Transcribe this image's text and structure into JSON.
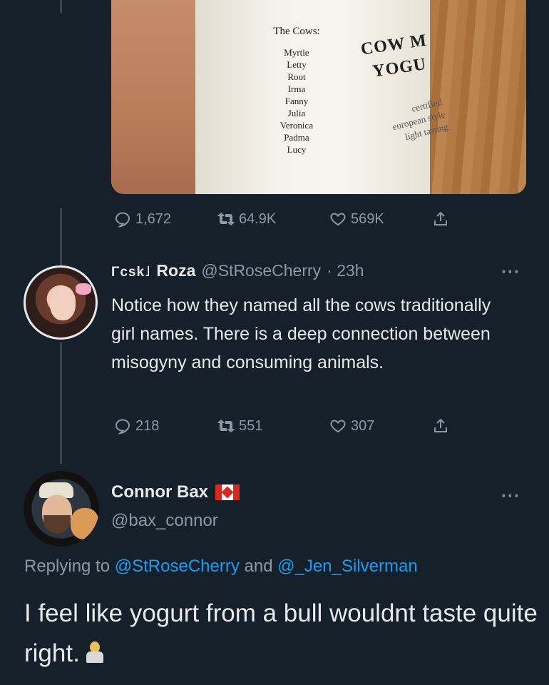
{
  "media": {
    "cows_title": "The Cows:",
    "cows": [
      "Myrtle",
      "Letty",
      "Root",
      "Irma",
      "Fanny",
      "Julia",
      "Veronica",
      "Padma",
      "Lucy"
    ],
    "brand_line1": "COW M",
    "brand_line2": "YOGU",
    "small_text": [
      "certified",
      "european style",
      "light tasting"
    ]
  },
  "original_tweet": {
    "replies": "1,672",
    "retweets": "64.9K",
    "likes": "569K"
  },
  "reply_tweet": {
    "badge": "Γcsk˩",
    "name": "Roza",
    "handle": "@StRoseCherry",
    "time": "· 23h",
    "more": "···",
    "text": "Notice how they named all the cows traditionally girl names. There is a deep connection between misogyny and consuming animals.",
    "replies": "218",
    "retweets": "551",
    "likes": "307"
  },
  "connor_tweet": {
    "name": "Connor Bax",
    "handle": "@bax_connor",
    "more": "···",
    "replying_prefix": "Replying to ",
    "mention1": "@StRoseCherry",
    "replying_and": " and ",
    "mention2": "@_Jen_Silverman",
    "text": "I feel like yogurt from a bull wouldnt taste quite right."
  },
  "icons": [
    "reply-icon",
    "retweet-icon",
    "like-icon",
    "share-icon",
    "canada-flag-icon",
    "shrug-emoji-icon"
  ],
  "colors": {
    "background": "#15202b",
    "text": "#e7e9ea",
    "secondary": "#8b98a5",
    "link": "#1d9bf0"
  }
}
